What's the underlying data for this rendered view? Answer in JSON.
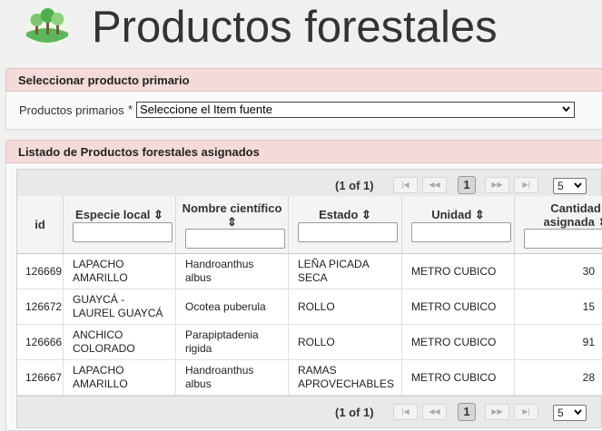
{
  "page": {
    "title": "Productos forestales"
  },
  "primary_panel": {
    "header": "Seleccionar producto primario",
    "field_label": "Productos primarios",
    "required_mark": "*",
    "select_value": "Seleccione el Item fuente"
  },
  "list_panel": {
    "header": "Listado de Productos forestales asignados",
    "paginator_top": {
      "text": "(1 of 1)",
      "current_page": "1",
      "rows_per_page": "5"
    },
    "paginator_bottom": {
      "text": "(1 of 1)",
      "current_page": "1",
      "rows_per_page": "5"
    },
    "columns": [
      {
        "label": "id",
        "sortable": false,
        "filter": false
      },
      {
        "label": "Especie local",
        "sortable": true,
        "filter": true
      },
      {
        "label": "Nombre científico",
        "sortable": true,
        "filter": true
      },
      {
        "label": "Estado",
        "sortable": true,
        "filter": true
      },
      {
        "label": "Unidad",
        "sortable": true,
        "filter": true
      },
      {
        "label": "Cantidad asignada",
        "sortable": true,
        "filter": true
      }
    ],
    "rows": [
      {
        "id": "126669",
        "especie": "LAPACHO AMARILLO",
        "nombre": "Handroanthus albus",
        "estado": "LEÑA PICADA SECA",
        "unidad": "METRO CUBICO",
        "cantidad": "30"
      },
      {
        "id": "126672",
        "especie": "GUAYCÁ - LAUREL GUAYCÁ",
        "nombre": "Ocotea puberula",
        "estado": "ROLLO",
        "unidad": "METRO CUBICO",
        "cantidad": "15"
      },
      {
        "id": "126666",
        "especie": "ANCHICO COLORADO",
        "nombre": "Parapiptadenia rigida",
        "estado": "ROLLO",
        "unidad": "METRO CUBICO",
        "cantidad": "91"
      },
      {
        "id": "126667",
        "especie": "LAPACHO AMARILLO",
        "nombre": "Handroanthus albus",
        "estado": "RAMAS APROVECHABLES",
        "unidad": "METRO CUBICO",
        "cantidad": "28"
      }
    ]
  },
  "icons": {
    "logo": "forest-logo-icon",
    "sort": "sort-icon",
    "dropdown": "chevron-down-icon"
  },
  "colors": {
    "panel_header_bg": "#f5dada",
    "background": "#f0f0f0"
  }
}
